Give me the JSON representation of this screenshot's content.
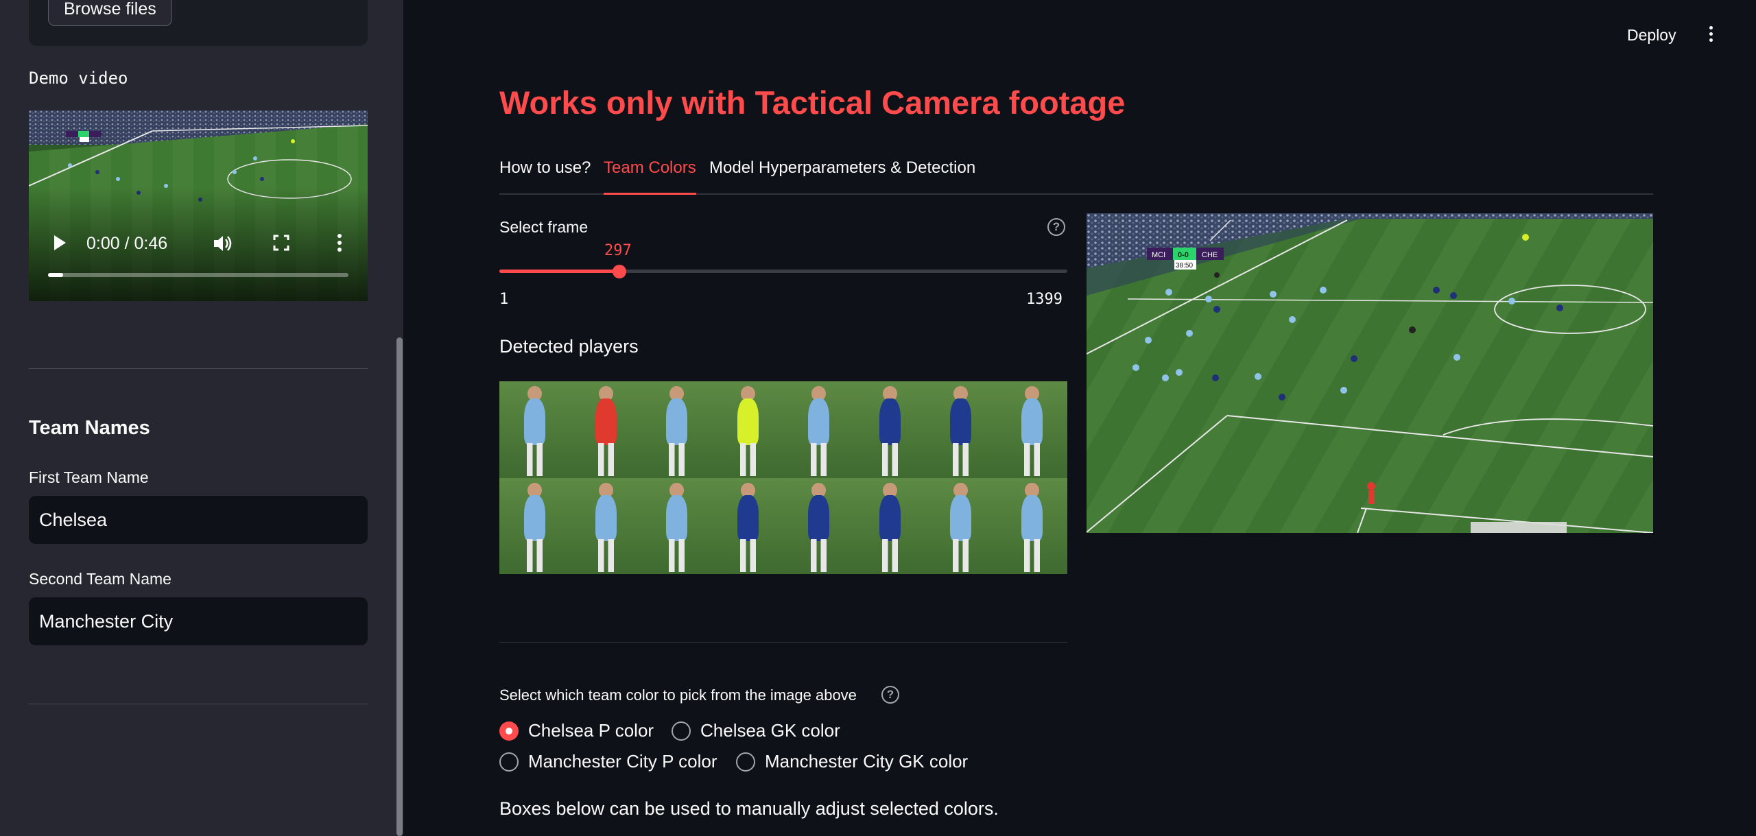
{
  "sidebar": {
    "browse_label": "Browse files",
    "demo_label": "Demo video",
    "video": {
      "time": "0:00 / 0:46",
      "progress": 0.05,
      "scoreboard": {
        "home": "MCI",
        "score": "0-0",
        "away": "CHE",
        "clock": "38:40"
      }
    },
    "team_names_heading": "Team Names",
    "first_team_label": "First Team Name",
    "first_team_value": "Chelsea",
    "second_team_label": "Second Team Name",
    "second_team_value": "Manchester City"
  },
  "header": {
    "deploy_label": "Deploy"
  },
  "main": {
    "title": "Works only with Tactical Camera footage",
    "tabs": [
      {
        "label": "How to use?",
        "active": false
      },
      {
        "label": "Team Colors",
        "active": true
      },
      {
        "label": "Model Hyperparameters & Detection",
        "active": false
      }
    ],
    "slider": {
      "label": "Select frame",
      "value": "297",
      "min": "1",
      "max": "1399"
    },
    "detected_heading": "Detected players",
    "frame_scoreboard": {
      "home": "MCI",
      "score": "0-0",
      "away": "CHE",
      "clock": "38:50"
    },
    "radio_label": "Select which team color to pick from the image above",
    "radio_options": [
      {
        "label": "Chelsea P color",
        "selected": true
      },
      {
        "label": "Chelsea GK color",
        "selected": false
      },
      {
        "label": "Manchester City P color",
        "selected": false
      },
      {
        "label": "Manchester City GK color",
        "selected": false
      }
    ],
    "note": "Boxes below can be used to manually adjust selected colors."
  },
  "colors": {
    "accent": "#ff4b4b",
    "background": "#0e1117",
    "sidebar": "#262730",
    "pitch": "#3d7233",
    "city_blue": "#7fb2df",
    "chelsea_blue": "#1f3a8f",
    "gk_red": "#e0392e",
    "gk_yellow": "#d8f02a"
  },
  "player_kits": [
    "city_blue",
    "gk_red",
    "city_blue",
    "gk_yellow",
    "city_blue",
    "chelsea_blue",
    "chelsea_blue",
    "city_blue",
    "city_blue",
    "city_blue",
    "city_blue",
    "chelsea_blue",
    "chelsea_blue",
    "chelsea_blue",
    "city_blue",
    "city_blue"
  ]
}
